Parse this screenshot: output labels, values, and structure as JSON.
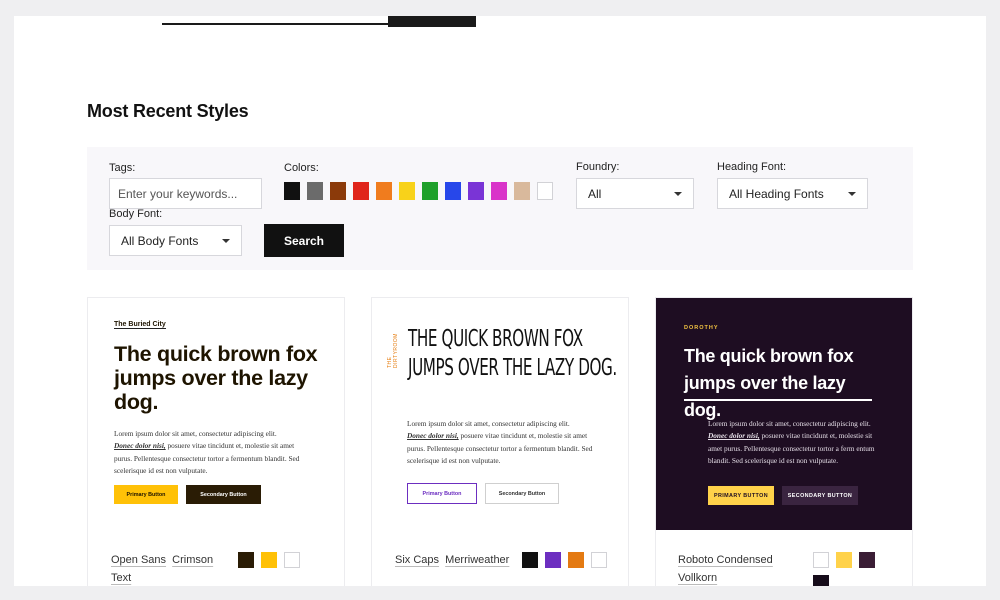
{
  "section_title": "Most Recent Styles",
  "filters": {
    "tags_label": "Tags:",
    "tags_placeholder": "Enter your keywords...",
    "colors_label": "Colors:",
    "colors": [
      "#111111",
      "#6b6b6b",
      "#8b3a0a",
      "#e0251b",
      "#f07c1e",
      "#f8d21a",
      "#1fa02b",
      "#2747ea",
      "#7a34d6",
      "#d934c9",
      "#d9b99c",
      "#ffffff"
    ],
    "foundry_label": "Foundry:",
    "foundry_value": "All",
    "heading_font_label": "Heading Font:",
    "heading_font_value": "All Heading Fonts",
    "body_font_label": "Body Font:",
    "body_font_value": "All Body Fonts",
    "search_label": "Search"
  },
  "cards": [
    {
      "kicker": "The Buried City",
      "headline": "The quick brown fox jumps over the lazy dog.",
      "body_line1": "Lorem ipsum dolor sit amet, consectetur adipiscing elit.",
      "body_emph": "Donec dolor nisi,",
      "body_rest": " posuere vitae tincidunt et, molestie sit amet purus. Pellentesque consectetur tortor a fermentum blandit. Sed scelerisque id est non vulputate.",
      "primary_label": "Primary Button",
      "secondary_label": "Secondary Button",
      "heading_font": "Open Sans",
      "body_font": "Crimson Text",
      "palette": [
        "#2a1c05",
        "#ffc107",
        "#ffffff"
      ]
    },
    {
      "kicker": "THE DIRTYROOM",
      "headline_line1": "THE QUICK BROWN FOX",
      "headline_line2": "JUMPS OVER THE LAZY DOG.",
      "body_line1": "Lorem ipsum dolor sit amet, consectetur adipiscing elit.",
      "body_emph": "Donec dolor nisi,",
      "body_rest": " posuere vitae tincidunt et, molestie sit amet purus. Pellentesque consectetur tortor a fermentum blandit. Sed scelerisque id est non vulputate.",
      "primary_label": "Primary Button",
      "secondary_label": "Secondary Button",
      "heading_font": "Six Caps",
      "body_font": "Merriweather",
      "palette": [
        "#111111",
        "#6c2ec0",
        "#e47a12",
        "#ffffff"
      ]
    },
    {
      "kicker": "DOROTHY",
      "headline": "The quick brown fox jumps over the lazy dog.",
      "body_line1": "Lorem ipsum dolor sit amet, consectetur adipiscing elit.",
      "body_emph": "Donec dolor nisi,",
      "body_rest": " posuere vitae tincidunt et, molestie sit amet purus. Pellentesque consectetur tortor a ferm entum blandit. Sed scelerisque id est non vulputate.",
      "primary_label": "PRIMARY BUTTON",
      "secondary_label": "SECONDARY BUTTON",
      "heading_font": "Roboto Condensed",
      "body_font": "Vollkorn",
      "palette": [
        "#ffffff",
        "#ffd24a",
        "#3a1d35",
        "#160c1a"
      ]
    }
  ]
}
